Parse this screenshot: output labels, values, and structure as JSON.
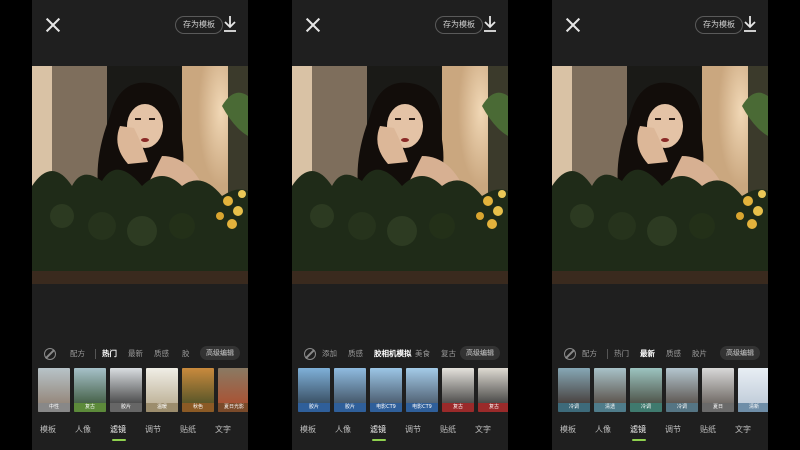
{
  "save_template": "存为模板",
  "advanced_edit": "高级编辑",
  "bottom_tabs": [
    "模板",
    "人像",
    "滤镜",
    "调节",
    "贴纸",
    "文字"
  ],
  "accent": "#8fd14f",
  "panels": [
    {
      "tabs": [
        "配方",
        "热门",
        "最新",
        "质感",
        "胶"
      ],
      "thumbs": [
        "中性",
        "复古",
        "胶片",
        "温暖",
        "秋色",
        "夏日光影"
      ]
    },
    {
      "tabs": [
        "添加",
        "质感",
        "胶相机模拟",
        "美食",
        "复古"
      ],
      "thumbs": [
        "胶片",
        "胶片",
        "电影CT9",
        "电影CT9",
        "复古",
        "复古"
      ]
    },
    {
      "tabs": [
        "配方",
        "热门",
        "最新",
        "质感",
        "胶片"
      ],
      "thumbs": [
        "冷调",
        "清透",
        "冷调",
        "冷调",
        "夏日",
        "清新"
      ]
    }
  ]
}
